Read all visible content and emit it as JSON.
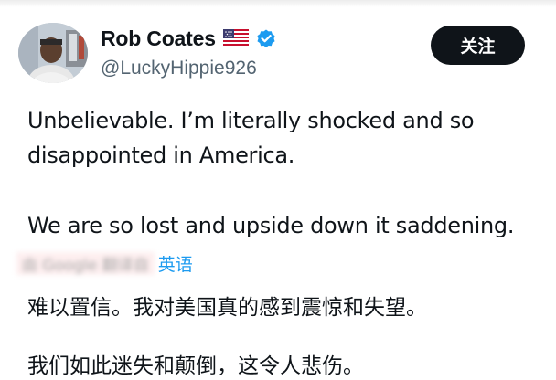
{
  "author": {
    "name": "Rob Coates",
    "handle": "@LuckyHippie926",
    "flag_icon": "us-flag-icon",
    "verified_icon": "verified-badge-icon",
    "verified_color": "#1d9bf0"
  },
  "follow_button": {
    "label": "关注",
    "background": "#0f1419"
  },
  "tweet": {
    "lines": [
      "Unbelievable. I’m literally shocked and so",
      "disappointed in America.",
      "We are so lost and upside down it saddening."
    ]
  },
  "translation": {
    "prefix": "由 Google 翻译自",
    "source_language": "英语",
    "link_color": "#1d9bf0",
    "lines": [
      "难以置信。我对美国真的感到震惊和失望。",
      "我们如此迷失和颠倒，这令人悲伤。"
    ]
  }
}
